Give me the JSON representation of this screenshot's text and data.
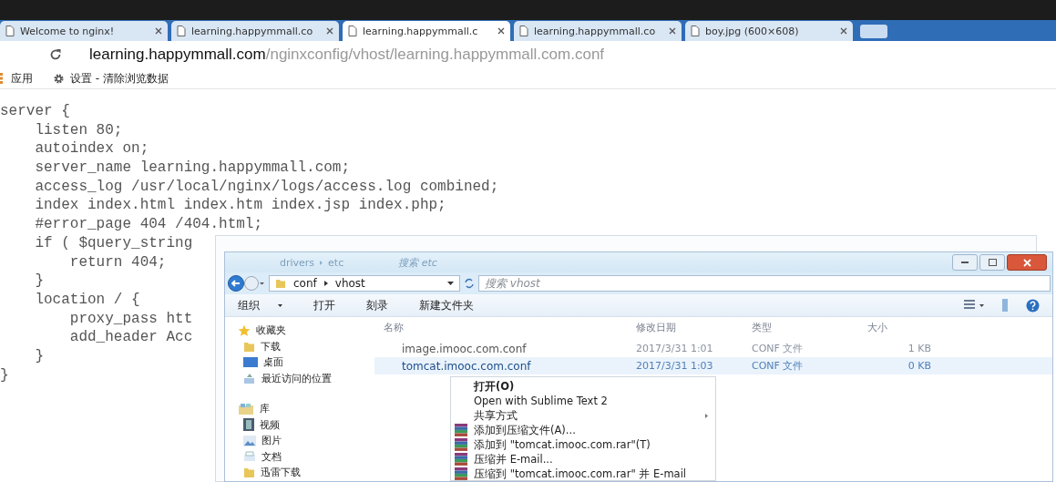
{
  "browser": {
    "tabs": [
      {
        "title": "Welcome to nginx!",
        "selected": false
      },
      {
        "title": "learning.happymmall.co",
        "selected": false
      },
      {
        "title": "learning.happymmall.c",
        "selected": true
      },
      {
        "title": "learning.happymmall.co",
        "selected": false
      },
      {
        "title": "boy.jpg (600×608)",
        "selected": false
      }
    ],
    "address": {
      "host": "learning.happymmall.com",
      "path": "/nginxconfig/vhost/learning.happymmall.com.conf"
    },
    "bookmarks": [
      {
        "label": "应用",
        "kind": "apps"
      },
      {
        "label": "设置 - 清除浏览数据",
        "kind": "settings"
      }
    ]
  },
  "code_lines": [
    "server {",
    "    listen 80;",
    "    autoindex on;",
    "    server_name learning.happymmall.com;",
    "    access_log /usr/local/nginx/logs/access.log combined;",
    "    index index.html index.htm index.jsp index.php;",
    "    #error_page 404 /404.html;",
    "    if ( $query_string",
    "        return 404;",
    "    }",
    "    location / {",
    "        proxy_pass htt",
    "        add_header Acc",
    "    }",
    "}"
  ],
  "explorer": {
    "behind": {
      "breadcrumb": [
        "drivers",
        "etc"
      ],
      "search_placeholder": "搜索 etc"
    },
    "breadcrumb": [
      "conf",
      "vhost"
    ],
    "search": {
      "placeholder": "搜索 vhost"
    },
    "toolbar": [
      {
        "label": "组织",
        "dropdown": true
      },
      {
        "label": "打开",
        "dropdown": false
      },
      {
        "label": "刻录",
        "dropdown": false
      },
      {
        "label": "新建文件夹",
        "dropdown": false
      }
    ],
    "nav": [
      {
        "label": "收藏夹",
        "kind": "star",
        "children": [
          {
            "label": "下载",
            "kind": "folder"
          },
          {
            "label": "桌面",
            "kind": "desktop"
          },
          {
            "label": "最近访问的位置",
            "kind": "recent"
          }
        ]
      },
      {
        "label": "库",
        "kind": "library",
        "children": [
          {
            "label": "视频",
            "kind": "video"
          },
          {
            "label": "图片",
            "kind": "picture"
          },
          {
            "label": "文档",
            "kind": "document"
          },
          {
            "label": "迅雷下载",
            "kind": "download"
          }
        ]
      }
    ],
    "columns": [
      "名称",
      "修改日期",
      "类型",
      "大小"
    ],
    "files": [
      {
        "name": "image.imooc.com.conf",
        "date": "2017/3/31 1:01",
        "type": "CONF 文件",
        "size": "1 KB",
        "selected": false
      },
      {
        "name": "tomcat.imooc.com.conf",
        "date": "2017/3/31 1:03",
        "type": "CONF 文件",
        "size": "0 KB",
        "selected": true
      }
    ],
    "context_menu": [
      {
        "label": "打开(O)",
        "kind": "default"
      },
      {
        "label": "Open with Sublime Text 2",
        "kind": "plain"
      },
      {
        "label": "共享方式",
        "kind": "submenu"
      },
      {
        "label": "添加到压缩文件(A)...",
        "kind": "archive"
      },
      {
        "label": "添加到 \"tomcat.imooc.com.rar\"(T)",
        "kind": "archive"
      },
      {
        "label": "压缩并 E-mail...",
        "kind": "archive"
      },
      {
        "label": "压缩到 \"tomcat.imooc.com.rar\" 并 E-mail",
        "kind": "archive"
      }
    ]
  }
}
